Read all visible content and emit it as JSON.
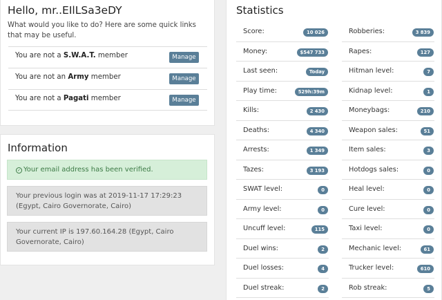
{
  "welcome": {
    "greeting": "Hello, mr..EIlLSa3eDY",
    "intro": "What would you like to do? Here are some quick links that may be useful.",
    "memberships": [
      {
        "prefix": "You are not a ",
        "group": "S.W.A.T.",
        "suffix": " member",
        "button": "Manage"
      },
      {
        "prefix": "You are not an ",
        "group": "Army",
        "suffix": " member",
        "button": "Manage"
      },
      {
        "prefix": "You are not a ",
        "group": "Pagati",
        "suffix": " member",
        "button": "Manage"
      }
    ]
  },
  "information": {
    "title": "Information",
    "verified_icon": "check-circle-icon",
    "verified": "Your email address has been verified.",
    "last_login": "Your previous login was at 2019-11-17 17:29:23 (Egypt, Cairo Governorate, Cairo)",
    "current_ip": "Your current IP is 197.60.164.28 (Egypt, Cairo Governorate, Cairo)"
  },
  "statistics": {
    "title": "Statistics",
    "left": [
      {
        "label": "Score:",
        "value": "10 026"
      },
      {
        "label": "Money:",
        "value": "$547 733"
      },
      {
        "label": "Last seen:",
        "value": "Today"
      },
      {
        "label": "Play time:",
        "value": "529h:39m"
      },
      {
        "label": "Kills:",
        "value": "2 430"
      },
      {
        "label": "Deaths:",
        "value": "4 340"
      },
      {
        "label": "Arrests:",
        "value": "1 349"
      },
      {
        "label": "Tazes:",
        "value": "3 193"
      },
      {
        "label": "SWAT level:",
        "value": "0"
      },
      {
        "label": "Army level:",
        "value": "0"
      },
      {
        "label": "Uncuff level:",
        "value": "115"
      },
      {
        "label": "Duel wins:",
        "value": "2"
      },
      {
        "label": "Duel losses:",
        "value": "4"
      },
      {
        "label": "Duel streak:",
        "value": "2"
      }
    ],
    "right": [
      {
        "label": "Robberies:",
        "value": "3 839"
      },
      {
        "label": "Rapes:",
        "value": "127"
      },
      {
        "label": "Hitman level:",
        "value": "7"
      },
      {
        "label": "Kidnap level:",
        "value": "1"
      },
      {
        "label": "Moneybags:",
        "value": "210"
      },
      {
        "label": "Weapon sales:",
        "value": "51"
      },
      {
        "label": "Item sales:",
        "value": "3"
      },
      {
        "label": "Hotdogs sales:",
        "value": "0"
      },
      {
        "label": "Heal level:",
        "value": "0"
      },
      {
        "label": "Cure level:",
        "value": "0"
      },
      {
        "label": "Taxi level:",
        "value": "0"
      },
      {
        "label": "Mechanic level:",
        "value": "61"
      },
      {
        "label": "Trucker level:",
        "value": "610"
      },
      {
        "label": "Rob streak:",
        "value": "5"
      }
    ]
  },
  "colors": {
    "badge": "#5a7f98",
    "success_bg": "#d6efd9",
    "info_bg": "#e2e2e2"
  }
}
